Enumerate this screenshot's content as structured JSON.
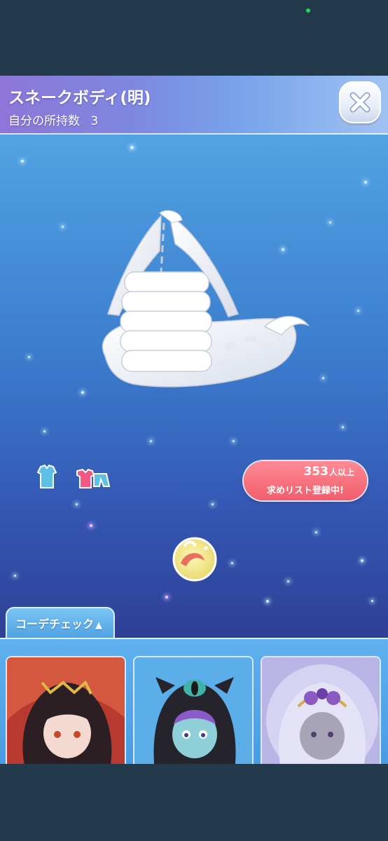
{
  "dialog": {
    "title": "スネークボディ(明)",
    "owned_label": "自分の所持数",
    "owned_count": "3"
  },
  "wanted_badge": {
    "count": "353",
    "count_suffix": "人以上",
    "label": "求めリスト登録中!"
  },
  "coord_check": {
    "tab_label": "コーデチェック",
    "tab_arrow": "▲",
    "cards": [
      {
        "name": "coord-card-1"
      },
      {
        "name": "coord-card-2"
      },
      {
        "name": "coord-card-3"
      }
    ]
  },
  "colors": {
    "scene_top": "#5aaee8",
    "scene_bottom": "#2c3684",
    "badge_pink": "#f25d6c",
    "tab_blue": "#4fa1e2",
    "status_dot": "#2fd158"
  }
}
